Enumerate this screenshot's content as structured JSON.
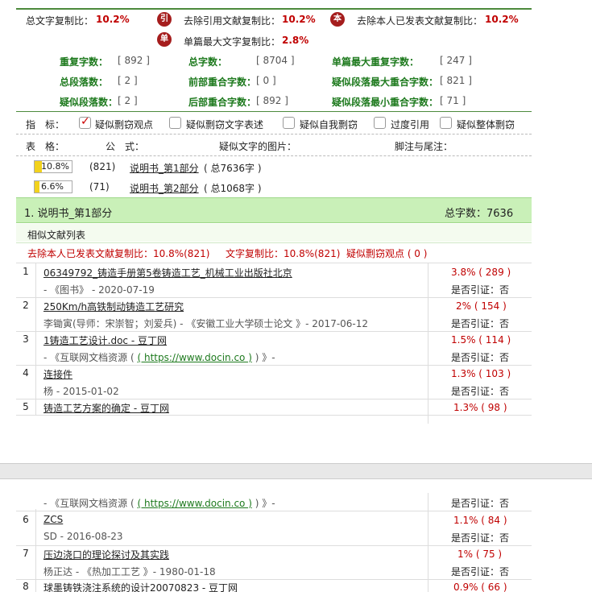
{
  "summary": {
    "total_copy_label": "总文字复制比：",
    "total_copy_value": "10.2%",
    "icon_yin": "引",
    "excl_cite_label": "去除引用文献复制比：",
    "excl_cite_value": "10.2%",
    "icon_ben": "本",
    "excl_self_label": "去除本人已发表文献复制比：",
    "excl_self_value": "10.2%",
    "icon_dan": "单",
    "single_max_label": "单篇最大文字复制比：",
    "single_max_value": "2.8%",
    "repeat_chars_label": "重复字数：",
    "repeat_chars_value": "[ 892 ]",
    "total_chars_label": "总字数：",
    "total_chars_value": "[ 8704 ]",
    "single_max_repeat_label": "单篇最大重复字数：",
    "single_max_repeat_value": "[ 247 ]",
    "total_paras_label": "总段落数：",
    "total_paras_value": "[ 2 ]",
    "front_overlap_label": "前部重合字数：",
    "front_overlap_value": "[ 0 ]",
    "sim_para_max_label": "疑似段落最大重合字数：",
    "sim_para_max_value": "[ 821 ]",
    "sim_paras_label": "疑似段落数：",
    "sim_paras_value": "[ 2 ]",
    "back_overlap_label": "后部重合字数：",
    "back_overlap_value": "[ 892 ]",
    "sim_para_min_label": "疑似段落最小重合字数：",
    "sim_para_min_value": "[ 71 ]"
  },
  "indicators": {
    "label": "指　标：",
    "items": [
      {
        "label": "疑似剽窃观点",
        "checked": true
      },
      {
        "label": "疑似剽窃文字表述",
        "checked": false
      },
      {
        "label": "疑似自我剽窃",
        "checked": false
      },
      {
        "label": "过度引用",
        "checked": false
      },
      {
        "label": "疑似整体剽窃",
        "checked": false
      }
    ]
  },
  "tables_row": {
    "label": "表　格：",
    "formula": "公　式：",
    "images": "疑似文字的图片：",
    "footnotes": "脚注与尾注："
  },
  "parts": [
    {
      "pct": "10.8%",
      "fill": 0.2,
      "count": "(821)",
      "name": "说明书_第1部分",
      "total": "( 总7636字 )"
    },
    {
      "pct": "6.6%",
      "fill": 0.13,
      "count": "(71)",
      "name": "说明书_第2部分",
      "total": "( 总1068字 )"
    }
  ],
  "section": {
    "title": "1. 说明书_第1部分",
    "total": "总字数：7636",
    "list_title": "相似文献列表",
    "stat_self": "去除本人已发表文献复制比：10.8%(821)",
    "stat_copy": "文字复制比：10.8%(821)",
    "stat_plag": "疑似剽窃观点 ( 0 )"
  },
  "docs": [
    {
      "num": "1",
      "title": "06349792_铸造手册第5卷铸造工艺_机械工业出版社北京",
      "meta": "- 《图书》 - 2020-07-19",
      "pct": "3.8% ( 289 )",
      "cite": "是否引证：否"
    },
    {
      "num": "2",
      "title": "250Km/h高铁制动铸造工艺研究",
      "meta": "李锄寅(导师：宋崇智；刘爱兵) - 《安徽工业大学硕士论文 》- 2017-06-12",
      "pct": "2% ( 154 )",
      "cite": "是否引证：否"
    },
    {
      "num": "3",
      "title": "1铸造工艺设计.doc - 豆丁网",
      "meta": "- 《互联网文档资源 ( ",
      "meta_link": "( https://www.docin.co )",
      "meta_tail": " ) 》-",
      "pct": "1.5% ( 114 )",
      "cite": "是否引证：否"
    },
    {
      "num": "4",
      "title": "连接件",
      "meta": "杨 - 2015-01-02",
      "pct": "1.3% ( 103 )",
      "cite": "是否引证：否"
    },
    {
      "num": "5",
      "title": "铸造工艺方案的确定 - 豆丁网",
      "pct": "1.3% ( 98 )"
    }
  ],
  "docs_p2": {
    "cont_meta": "- 《互联网文档资源 ( ",
    "cont_link": "( https://www.docin.co )",
    "cont_tail": " ) 》-",
    "cont_cite": "是否引证：否",
    "rows": [
      {
        "num": "6",
        "title": "ZCS",
        "meta": "SD - 2016-08-23",
        "pct": "1.1% ( 84 )",
        "cite": "是否引证：否"
      },
      {
        "num": "7",
        "title": "压边浇口的理论探讨及其实践",
        "meta": "杨正达 - 《热加工工艺 》- 1980-01-18",
        "pct": "1% ( 75 )",
        "cite": "是否引证：否"
      },
      {
        "num": "8",
        "title": "球墨铸铁浇注系统的设计20070823 - 豆丁网",
        "pct": "0.9% ( 66 )"
      }
    ]
  }
}
